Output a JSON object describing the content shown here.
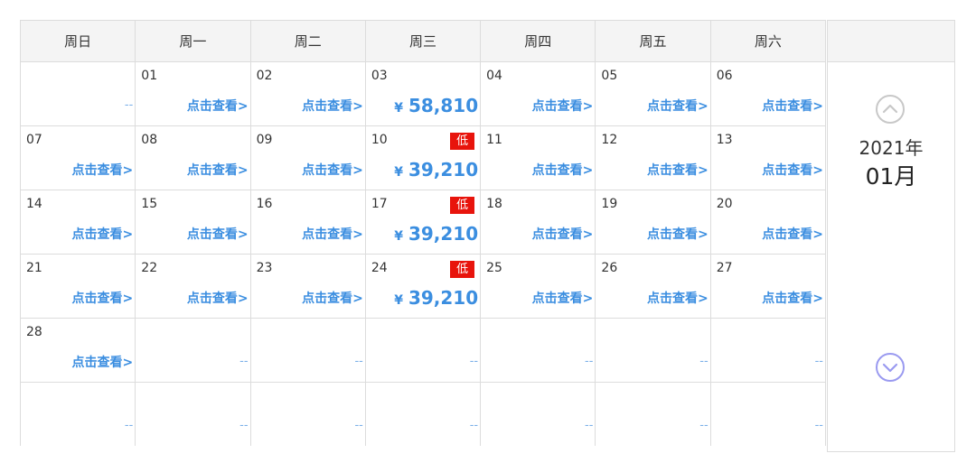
{
  "weekdays": [
    "周日",
    "周一",
    "周二",
    "周三",
    "周四",
    "周五",
    "周六"
  ],
  "link_text": "点击查看>",
  "dash": "--",
  "currency": "¥",
  "low_badge": "低",
  "colors": {
    "accent": "#3b8ee0",
    "badge": "#e8140c",
    "header_bg": "#f4f4f4",
    "border": "#dcdcdc"
  },
  "weeks": [
    [
      {
        "day": "",
        "kind": "dash"
      },
      {
        "day": "01",
        "kind": "link"
      },
      {
        "day": "02",
        "kind": "link"
      },
      {
        "day": "03",
        "kind": "price",
        "price": "58,810"
      },
      {
        "day": "04",
        "kind": "link"
      },
      {
        "day": "05",
        "kind": "link"
      },
      {
        "day": "06",
        "kind": "link"
      }
    ],
    [
      {
        "day": "07",
        "kind": "link"
      },
      {
        "day": "08",
        "kind": "link"
      },
      {
        "day": "09",
        "kind": "link"
      },
      {
        "day": "10",
        "kind": "price",
        "price": "39,210",
        "badge": true
      },
      {
        "day": "11",
        "kind": "link"
      },
      {
        "day": "12",
        "kind": "link"
      },
      {
        "day": "13",
        "kind": "link"
      }
    ],
    [
      {
        "day": "14",
        "kind": "link"
      },
      {
        "day": "15",
        "kind": "link"
      },
      {
        "day": "16",
        "kind": "link"
      },
      {
        "day": "17",
        "kind": "price",
        "price": "39,210",
        "badge": true
      },
      {
        "day": "18",
        "kind": "link"
      },
      {
        "day": "19",
        "kind": "link"
      },
      {
        "day": "20",
        "kind": "link"
      }
    ],
    [
      {
        "day": "21",
        "kind": "link"
      },
      {
        "day": "22",
        "kind": "link"
      },
      {
        "day": "23",
        "kind": "link"
      },
      {
        "day": "24",
        "kind": "price",
        "price": "39,210",
        "badge": true
      },
      {
        "day": "25",
        "kind": "link"
      },
      {
        "day": "26",
        "kind": "link"
      },
      {
        "day": "27",
        "kind": "link"
      }
    ],
    [
      {
        "day": "28",
        "kind": "link"
      },
      {
        "day": "",
        "kind": "dash"
      },
      {
        "day": "",
        "kind": "dash"
      },
      {
        "day": "",
        "kind": "dash"
      },
      {
        "day": "",
        "kind": "dash"
      },
      {
        "day": "",
        "kind": "dash"
      },
      {
        "day": "",
        "kind": "dash"
      }
    ],
    [
      {
        "day": "",
        "kind": "dash"
      },
      {
        "day": "",
        "kind": "dash"
      },
      {
        "day": "",
        "kind": "dash"
      },
      {
        "day": "",
        "kind": "dash"
      },
      {
        "day": "",
        "kind": "dash"
      },
      {
        "day": "",
        "kind": "dash"
      },
      {
        "day": "",
        "kind": "dash"
      }
    ]
  ],
  "side": {
    "year": "2021年",
    "month": "01月",
    "prev_icon": "chevron-up-circle",
    "next_icon": "chevron-down-circle"
  }
}
